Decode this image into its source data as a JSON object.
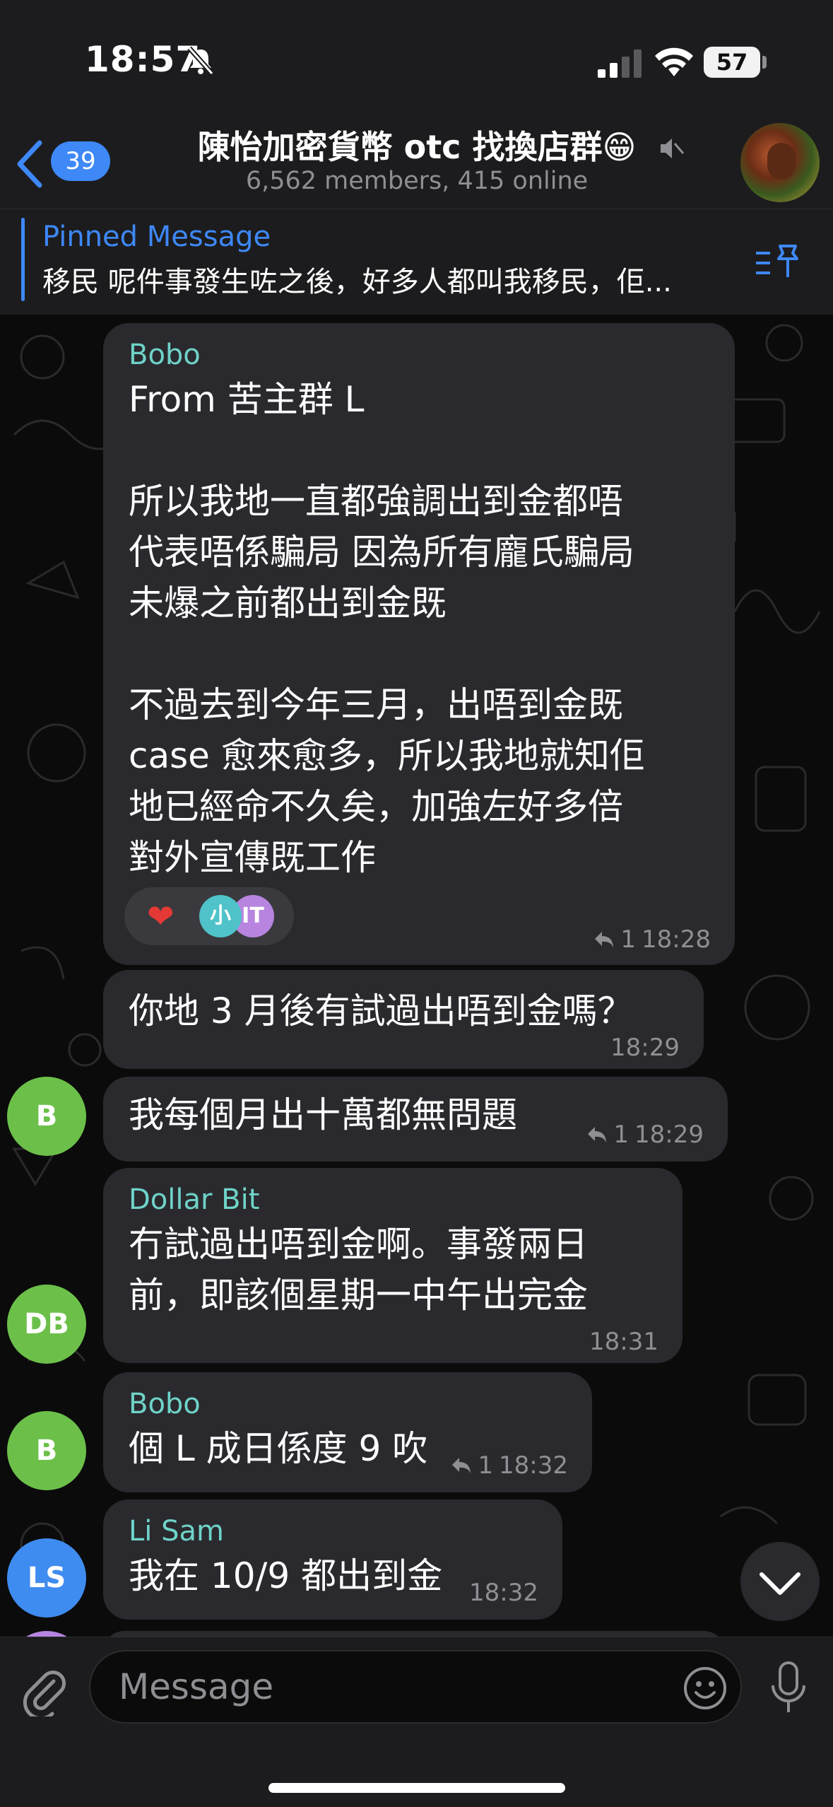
{
  "status_bar": {
    "time": "18:57",
    "battery": "57"
  },
  "header": {
    "back_count": "39",
    "title": "陳怡加密貨幣 otc 找換店群😁",
    "subtitle": "6,562 members, 415 online"
  },
  "pinned": {
    "label": "Pinned Message",
    "text": "移民 呢件事發生咗之後，好多人都叫我移民，佢..."
  },
  "messages": [
    {
      "sender": "Bobo",
      "text": "From 苦主群 L\n\n所以我地一直都強調出到金都唔\n代表唔係騙局 因為所有龐氏騙局\n未爆之前都出到金既\n\n不過去到今年三月，出唔到金既\ncase 愈來愈多，所以我地就知佢\n地已經命不久矣，加強左好多倍\n對外宣傳既工作",
      "replies": "1",
      "time": "18:28",
      "reactions": {
        "heart": "❤",
        "user1": "小",
        "user2": "IT"
      }
    },
    {
      "text": "你地 3 月後有試過出唔到金嗎？",
      "time": "18:29"
    },
    {
      "text": "我每個月出十萬都無問題",
      "replies": "1",
      "time": "18:29",
      "avatar": "B"
    },
    {
      "sender": "Dollar Bit",
      "text": "冇試過出唔到金啊。事發兩日\n前，即該個星期一中午出完金",
      "time": "18:31",
      "avatar": "DB"
    },
    {
      "sender": "Bobo",
      "text": "個 L 成日係度 9 吹",
      "replies": "1",
      "time": "18:32",
      "avatar": "B"
    },
    {
      "sender": "Li Sam",
      "text": "我在 10/9 都出到金",
      "time": "18:32",
      "avatar": "LS"
    }
  ],
  "composer": {
    "placeholder": "Message"
  },
  "colors": {
    "accent": "#3e88f7",
    "sender_name": "#6fd3c8",
    "avatar_green": "#6cc04a",
    "avatar_blue": "#3f8cf0"
  }
}
